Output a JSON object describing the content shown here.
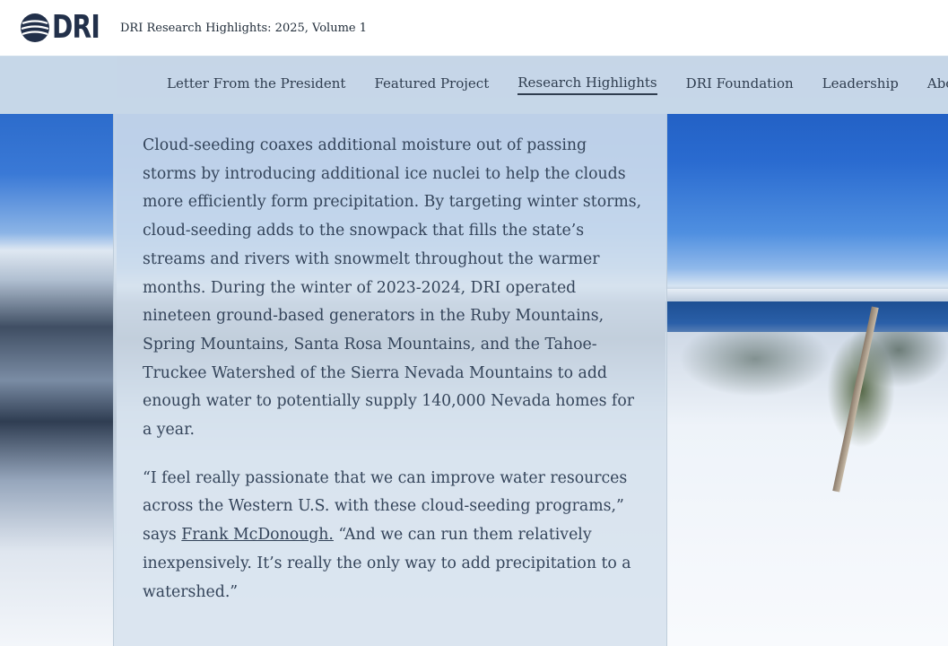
{
  "header": {
    "logo_text": "DRI",
    "site_title": "DRI Research Highlights: 2025, Volume 1"
  },
  "nav": {
    "items": [
      {
        "label": "Letter From the President",
        "active": false
      },
      {
        "label": "Featured Project",
        "active": false
      },
      {
        "label": "Research Highlights",
        "active": true
      },
      {
        "label": "DRI Foundation",
        "active": false
      },
      {
        "label": "Leadership",
        "active": false
      },
      {
        "label": "Abo",
        "active": false
      }
    ]
  },
  "content": {
    "paragraph1": "Cloud-seeding coaxes additional moisture out of passing storms by introducing additional ice nuclei to help the clouds more efficiently form precipitation. By targeting winter storms, cloud-seeding adds to the snowpack that fills the state’s streams and rivers with snowmelt throughout the warmer months. During the winter of 2023-2024, DRI operated nineteen ground-based generators in the Ruby Mountains, Spring Mountains, Santa Rosa Mountains, and the Tahoe-Truckee Watershed of the Sierra Nevada Mountains to add enough water to potentially supply 140,000 Nevada homes for a year.",
    "paragraph2_before": "“I feel really passionate that we can improve water resources across the Western U.S. with these cloud-seeding programs,” says ",
    "paragraph2_link": "Frank McDonough.",
    "paragraph2_after": " “And we can run them relatively inexpensively. It’s really the only way to add precipitation to a watershed.”"
  },
  "colors": {
    "header_bg": "#ffffff",
    "nav_bg": "#cddce9",
    "panel_bg": "#d6e2ee",
    "text": "#34445a",
    "logo": "#22304a"
  }
}
